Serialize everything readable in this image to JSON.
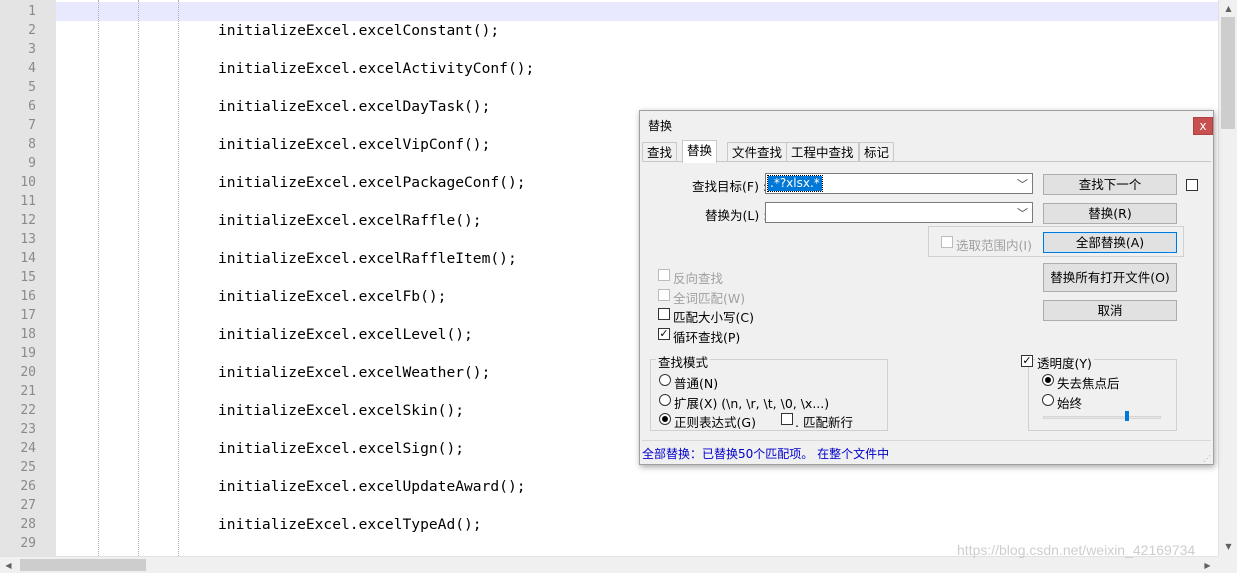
{
  "editor": {
    "line_numbers": [
      "1",
      "2",
      "3",
      "4",
      "5",
      "6",
      "7",
      "8",
      "9",
      "10",
      "11",
      "12",
      "13",
      "14",
      "15",
      "16",
      "17",
      "18",
      "19",
      "20",
      "21",
      "22",
      "23",
      "24",
      "25",
      "26",
      "27",
      "28",
      "29"
    ],
    "code_lines": [
      "",
      "initializeExcel.excelConstant();",
      "",
      "initializeExcel.excelActivityConf();",
      "",
      "initializeExcel.excelDayTask();",
      "",
      "initializeExcel.excelVipConf();",
      "",
      "initializeExcel.excelPackageConf();",
      "",
      "initializeExcel.excelRaffle();",
      "",
      "initializeExcel.excelRaffleItem();",
      "",
      "initializeExcel.excelFb();",
      "",
      "initializeExcel.excelLevel();",
      "",
      "initializeExcel.excelWeather();",
      "",
      "initializeExcel.excelSkin();",
      "",
      "initializeExcel.excelSign();",
      "",
      "initializeExcel.excelUpdateAward();",
      "",
      "initializeExcel.excelTypeAd();",
      ""
    ],
    "watermark": "https://blog.csdn.net/weixin_42169734"
  },
  "dialog": {
    "title": "替换",
    "close_label": "x",
    "tabs": [
      "查找",
      "替换",
      "文件查找",
      "工程中查找",
      "标记"
    ],
    "active_tab": "替换",
    "find_label": "查找目标(F) :",
    "find_value": ".*?xlsx.*",
    "replace_label": "替换为(L) :",
    "replace_value": "",
    "buttons": {
      "find_next": "查找下一个",
      "replace": "替换(R)",
      "replace_all": "全部替换(A)",
      "replace_all_open": "替换所有打开文件(O)",
      "cancel": "取消"
    },
    "in_selection_label": "选取范围内(I)",
    "options": {
      "backward": "反向查找",
      "whole_word": "全词匹配(W)",
      "match_case": "匹配大小写(C)",
      "wrap_around": "循环查找(P)"
    },
    "search_mode": {
      "title": "查找模式",
      "normal": "普通(N)",
      "extended": "扩展(X) (\\n, \\r, \\t, \\0, \\x...)",
      "regex": "正则表达式(G)",
      "dot_newline": ". 匹配新行"
    },
    "transparency": {
      "title": "透明度(Y)",
      "on_lose_focus": "失去焦点后",
      "always": "始终",
      "level": 0.72
    },
    "status": "全部替换：已替换50个匹配项。 在整个文件中",
    "colors": {
      "selection": "#0078d7",
      "status_text": "#0000cc",
      "close_button": "#c75050"
    }
  }
}
